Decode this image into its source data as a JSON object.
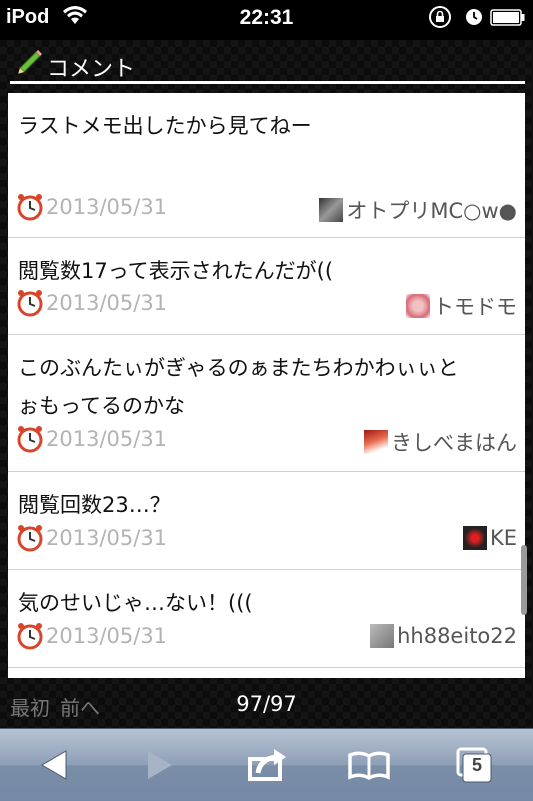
{
  "status_bar": {
    "carrier": "iPod",
    "time": "22:31"
  },
  "header": {
    "title": "コメント",
    "icon": "pencil-icon"
  },
  "comments": [
    {
      "text": "ラストメモ出したから見てねー",
      "date": "2013/05/31",
      "author": "オトプリMC○w●"
    },
    {
      "text": "閲覧数17って表示されたんだが((",
      "date": "2013/05/31",
      "author": "トモドモ"
    },
    {
      "text": "このぶんたぃがぎゃるのぁまたちわかわぃぃと\nぉもってるのかな",
      "date": "2013/05/31",
      "author": "きしべまはん"
    },
    {
      "text": "閲覧回数23…？",
      "date": "2013/05/31",
      "author": "KE"
    },
    {
      "text": "気のせいじゃ…ない！(((",
      "date": "2013/05/31",
      "author": "hh88eito22"
    }
  ],
  "pager": {
    "first": "最初",
    "prev": "前へ",
    "count": "97/97"
  },
  "toolbar": {
    "tabs_count": "5",
    "icons": [
      "back-icon",
      "forward-icon",
      "share-icon",
      "bookmarks-icon",
      "tabs-icon"
    ]
  },
  "colors": {
    "background": "#000000",
    "card": "#ffffff",
    "date_text": "#b3b3b3",
    "toolbar": "#8e9fb6"
  }
}
